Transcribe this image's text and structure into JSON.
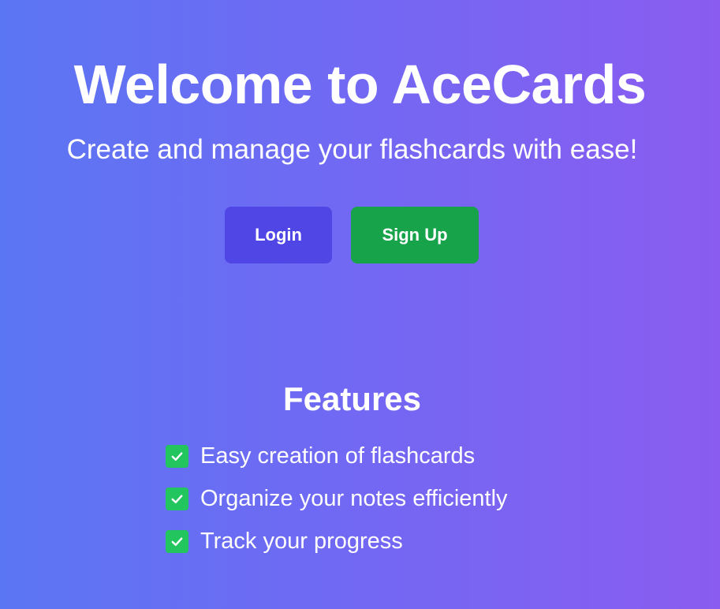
{
  "hero": {
    "title": "Welcome to AceCards",
    "subtitle": "Create and manage your flashcards with ease!"
  },
  "actions": {
    "login_label": "Login",
    "signup_label": "Sign Up"
  },
  "features": {
    "title": "Features",
    "items": [
      {
        "icon": "check-icon",
        "label": "Easy creation of flashcards"
      },
      {
        "icon": "check-icon",
        "label": "Organize your notes efficiently"
      },
      {
        "icon": "check-icon",
        "label": "Track your progress"
      }
    ]
  },
  "colors": {
    "gradient_start": "#5b76f3",
    "gradient_end": "#8a5cf0",
    "login_button": "#4f46e5",
    "signup_button": "#16a34a",
    "check": "#22c55e"
  }
}
